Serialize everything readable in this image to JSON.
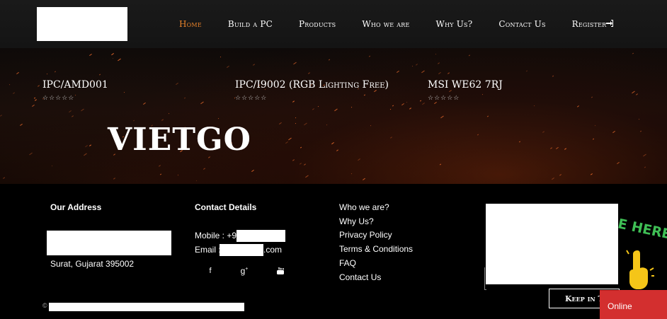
{
  "nav": {
    "items": [
      {
        "label": "Home",
        "active": true
      },
      {
        "label": "Build a PC",
        "active": false
      },
      {
        "label": "Products",
        "active": false
      },
      {
        "label": "Who we are",
        "active": false
      },
      {
        "label": "Why Us?",
        "active": false
      },
      {
        "label": "Contact Us",
        "active": false
      },
      {
        "label": "Register",
        "active": false
      }
    ],
    "login_icon": "sign-in-icon"
  },
  "products": [
    {
      "title": "IPC/AMD001",
      "rating": 0,
      "stars": "☆☆☆☆☆"
    },
    {
      "title": "IPC/I9002 (RGB Lighting Free)",
      "rating": 0,
      "stars": "☆☆☆☆☆"
    },
    {
      "title": "MSI WE62 7RJ",
      "rating": 0,
      "stars": "☆☆☆☆☆"
    }
  ],
  "brand": "VIETGO",
  "footer": {
    "address": {
      "title": "Our Address",
      "city": "Surat, Gujarat 395002"
    },
    "contact": {
      "title": "Contact Details",
      "mobile_label": "Mobile : +91",
      "email_label": "Email :",
      "email_suffix": ".com",
      "social": [
        "facebook-icon",
        "google-plus-icon",
        "youtube-icon"
      ]
    },
    "links": [
      "Who we are?",
      "Why Us?",
      "Privacy Policy",
      "Terms & Conditions",
      "FAQ",
      "Contact Us"
    ],
    "keep_in_touch": "Keep in To",
    "copyright_symbol": "©"
  },
  "chat": {
    "banner": "E HERE!",
    "status": "Online"
  },
  "colors": {
    "accent": "#e8832a",
    "chat_green": "#3fbf55",
    "online_red": "#d32f2f",
    "hand_yellow": "#f5c518"
  }
}
